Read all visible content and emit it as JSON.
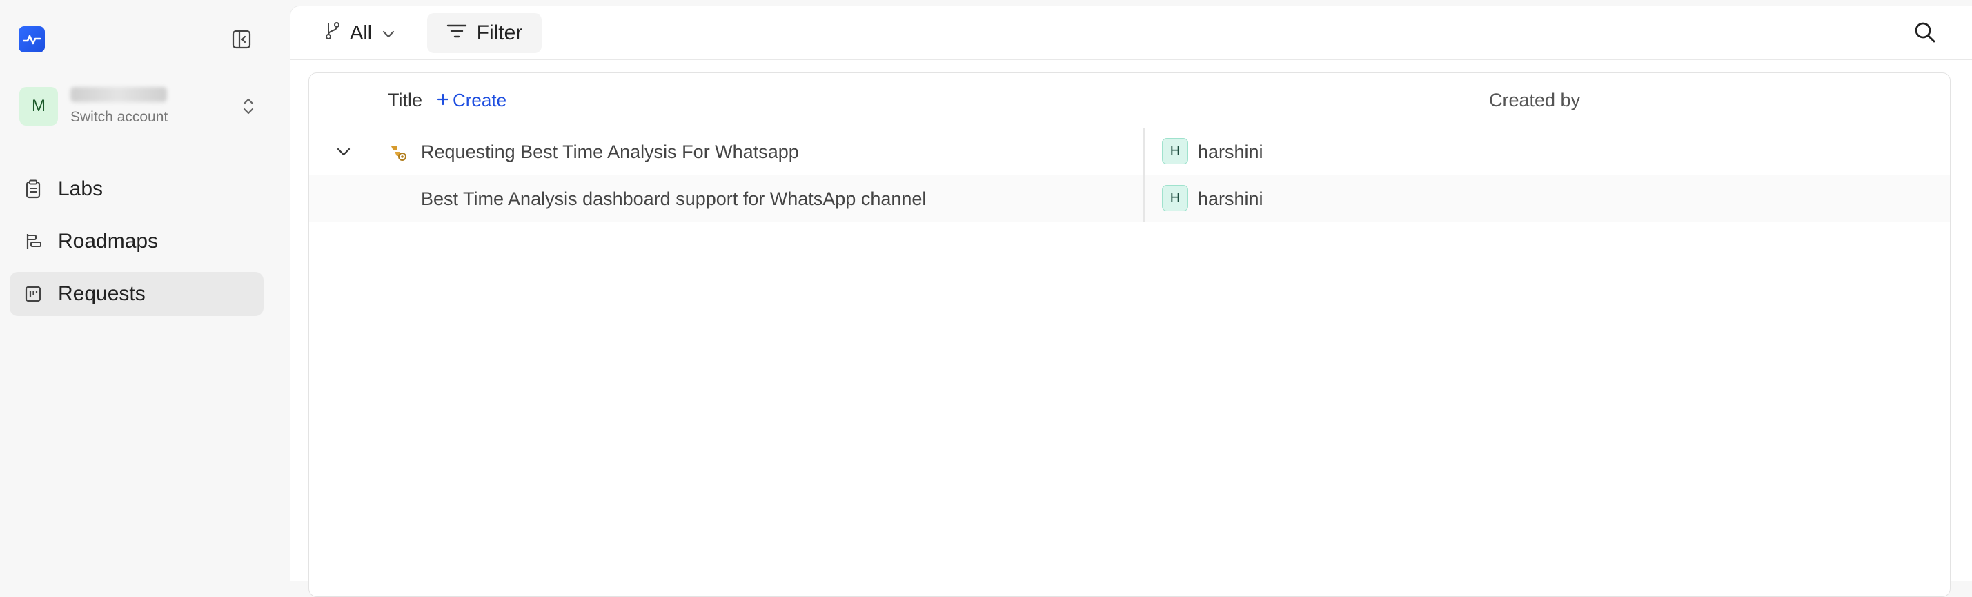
{
  "account": {
    "avatar_letter": "M",
    "switch_label": "Switch account"
  },
  "sidebar": {
    "items": [
      {
        "label": "Labs",
        "icon": "clipboard-icon"
      },
      {
        "label": "Roadmaps",
        "icon": "roadmap-icon"
      },
      {
        "label": "Requests",
        "icon": "board-icon",
        "active": true
      }
    ]
  },
  "toolbar": {
    "branch_label": "All",
    "filter_label": "Filter"
  },
  "table": {
    "columns": {
      "title": "Title",
      "create": "Create",
      "created_by": "Created by"
    },
    "rows": [
      {
        "title": "Requesting Best Time Analysis For Whatsapp",
        "user_initial": "H",
        "user": "harshini",
        "expandable": true
      },
      {
        "title": "Best Time Analysis dashboard support for WhatsApp channel",
        "user_initial": "H",
        "user": "harshini",
        "expandable": false
      }
    ]
  },
  "colors": {
    "accent": "#1f4fe0",
    "logo": "#2f6bff",
    "active_nav": "#e9e9e9"
  }
}
